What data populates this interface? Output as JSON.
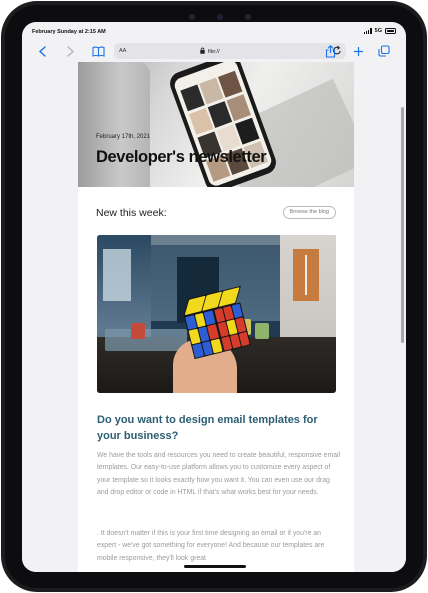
{
  "status_bar": {
    "datetime": "February Sunday at 2:15 AM",
    "network": "5G"
  },
  "toolbar": {
    "aa_label": "AA",
    "url": "file://",
    "icons": [
      "back-icon",
      "forward-icon",
      "book-icon",
      "lock-icon",
      "reload-icon",
      "share-icon",
      "plus-icon",
      "tabs-icon"
    ]
  },
  "hero": {
    "date": "February 17th, 2021",
    "title": "Developer's newsletter"
  },
  "new_this_week": {
    "heading": "New this week:",
    "browse_button": "Browse the blog"
  },
  "article": {
    "title": "Do you want to design email templates for your business?",
    "paragraph_1": "We have the tools and resources you need to create beautiful, responsive email templates. Our easy-to-use platform allows you to customize every aspect of your template so it looks exactly how you want it. You can even use our drag and drop editor or code in HTML if that's what works best for your needs.",
    "paragraph_2": ". It doesn't matter if this is your first time designing an email or if you're an expert - we've got something for everyone! And because our templates are mobile responsive, they'll look great"
  },
  "colors": {
    "accent": "#1a73e8",
    "article_title": "#2c5e74",
    "body_text": "#9b9b9b"
  }
}
